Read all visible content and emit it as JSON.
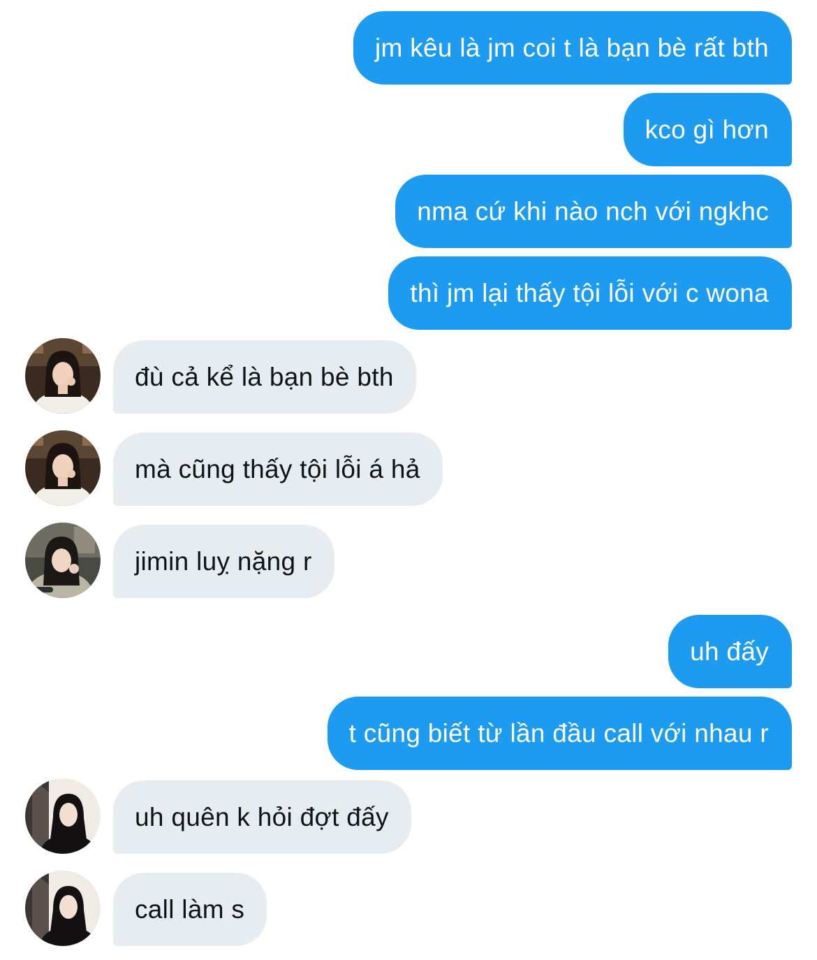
{
  "colors": {
    "outgoing_bubble": "#1d9bf0",
    "incoming_bubble": "#e7ecf0",
    "outgoing_text": "#ffffff",
    "incoming_text": "#0f1419"
  },
  "messages": [
    {
      "direction": "outgoing",
      "text": "jm kêu là jm coi t là bạn bè rất bth"
    },
    {
      "direction": "outgoing",
      "text": "kco gì hơn"
    },
    {
      "direction": "outgoing",
      "text": "nma cứ khi nào nch với ngkhc"
    },
    {
      "direction": "outgoing",
      "text": "thì jm lại thấy tội lỗi với c wona"
    },
    {
      "direction": "incoming",
      "avatar": "avatar-photo-girl-white-top",
      "text": "đù cả kể là bạn bè bth"
    },
    {
      "direction": "incoming",
      "avatar": "avatar-photo-girl-white-top",
      "text": "mà cũng thấy tội lỗi á hả"
    },
    {
      "direction": "incoming",
      "avatar": "avatar-photo-girl-cafe",
      "text": "jimin luỵ nặng r"
    },
    {
      "direction": "outgoing",
      "text": "uh đấy"
    },
    {
      "direction": "outgoing",
      "text": "t cũng biết từ lần đầu call với nhau r"
    },
    {
      "direction": "incoming",
      "avatar": "avatar-photo-girl-dark-hair",
      "text": "uh quên k hỏi đợt đấy"
    },
    {
      "direction": "incoming",
      "avatar": "avatar-photo-girl-dark-hair",
      "text": "call làm s"
    }
  ]
}
